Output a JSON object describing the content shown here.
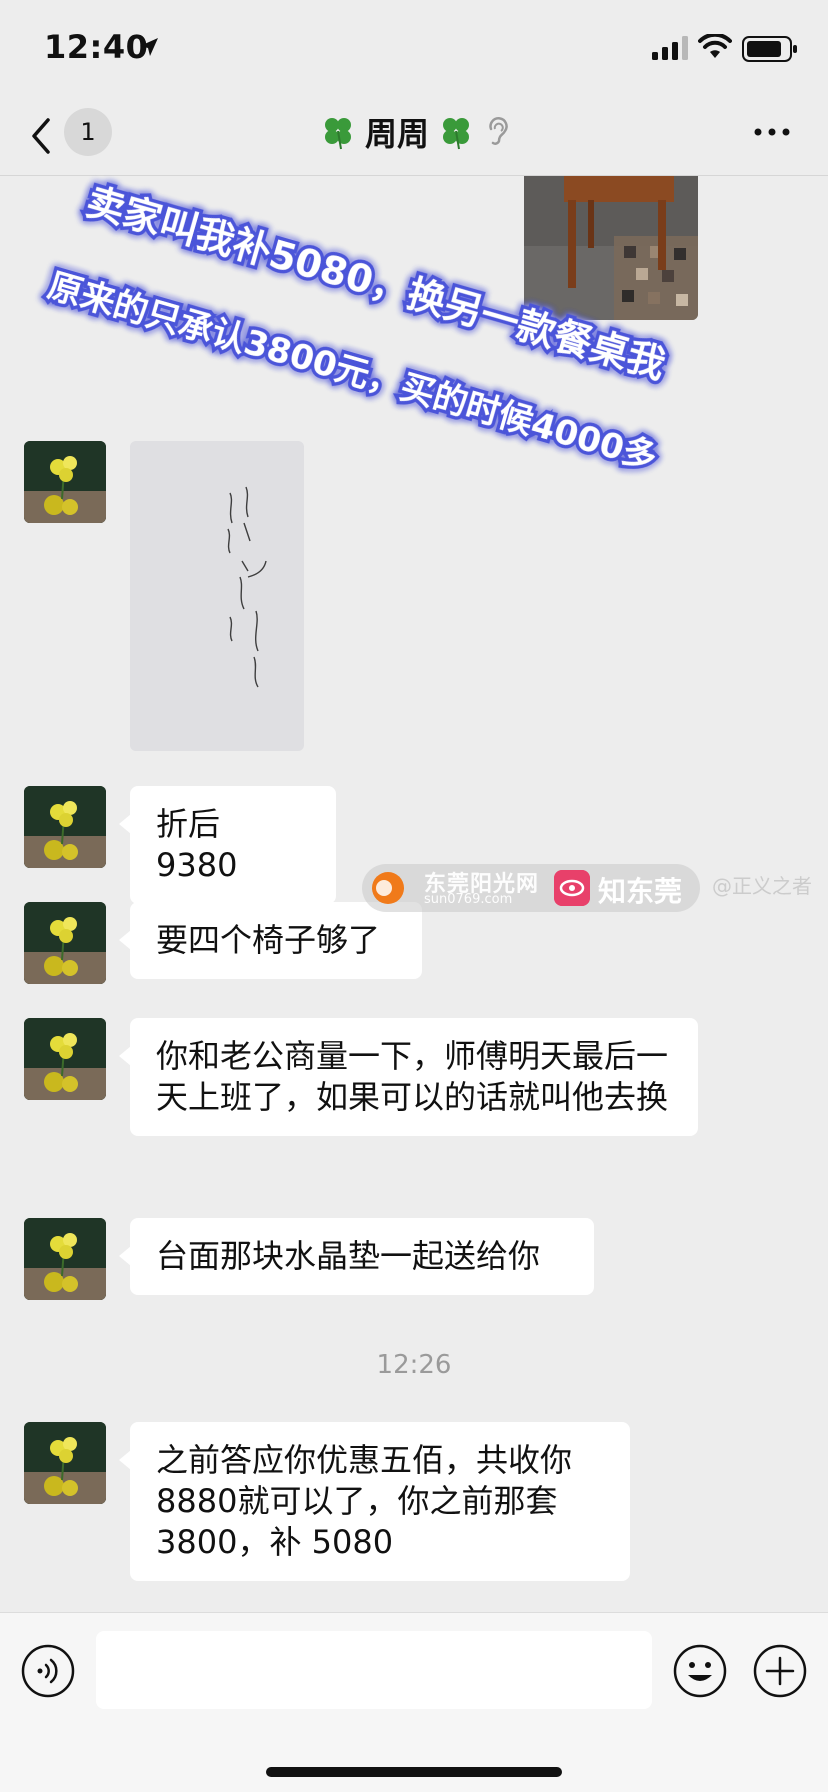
{
  "status_bar": {
    "time": "12:40",
    "icons": [
      "location-arrow-icon",
      "cellular-signal-icon",
      "wifi-icon",
      "battery-icon"
    ]
  },
  "header": {
    "back_icon": "chevron-left-icon",
    "unread_count": "1",
    "title": "周周",
    "title_decoration": "four-leaf-clover-icon",
    "earpiece_icon": "ear-icon",
    "more_icon": "ellipsis-icon"
  },
  "overlay_caption": {
    "line1": "卖家叫我补5080，换另一款餐桌我",
    "line2": "原来的只承认3800元，买的时候4000多",
    "color": "#ffffff",
    "glow_color": "#4b55d9"
  },
  "messages": [
    {
      "type": "image",
      "sender": "self",
      "content": "chair-photo"
    },
    {
      "type": "image",
      "sender": "other",
      "content": "handwritten-receipt-photo"
    },
    {
      "type": "text",
      "sender": "other",
      "text": "折后 9380"
    },
    {
      "type": "text",
      "sender": "other",
      "text": "要四个椅子够了"
    },
    {
      "type": "text",
      "sender": "other",
      "text": "你和老公商量一下，师傅明天最后一天上班了，如果可以的话就叫他去换"
    },
    {
      "type": "text",
      "sender": "other",
      "text": "台面那块水晶垫一起送给你"
    },
    {
      "type": "timestamp",
      "text": "12:26"
    },
    {
      "type": "text",
      "sender": "other",
      "text": "之前答应你优惠五佰，共收你 8880就可以了，你之前那套3800，补 5080"
    }
  ],
  "watermark": {
    "sun_name": "东莞阳光网",
    "sun_url": "sun0769.com",
    "zhi_name": "知东莞",
    "tag": "@正义之者"
  },
  "input_bar": {
    "icons": [
      "voice-icon",
      "emoji-icon",
      "plus-icon"
    ],
    "placeholder": ""
  },
  "colors": {
    "background": "#ededed",
    "bubble": "#ffffff",
    "timestamp": "#9a9a9a",
    "watermark_orange": "#f07a1a",
    "watermark_pink": "#e8406a"
  }
}
